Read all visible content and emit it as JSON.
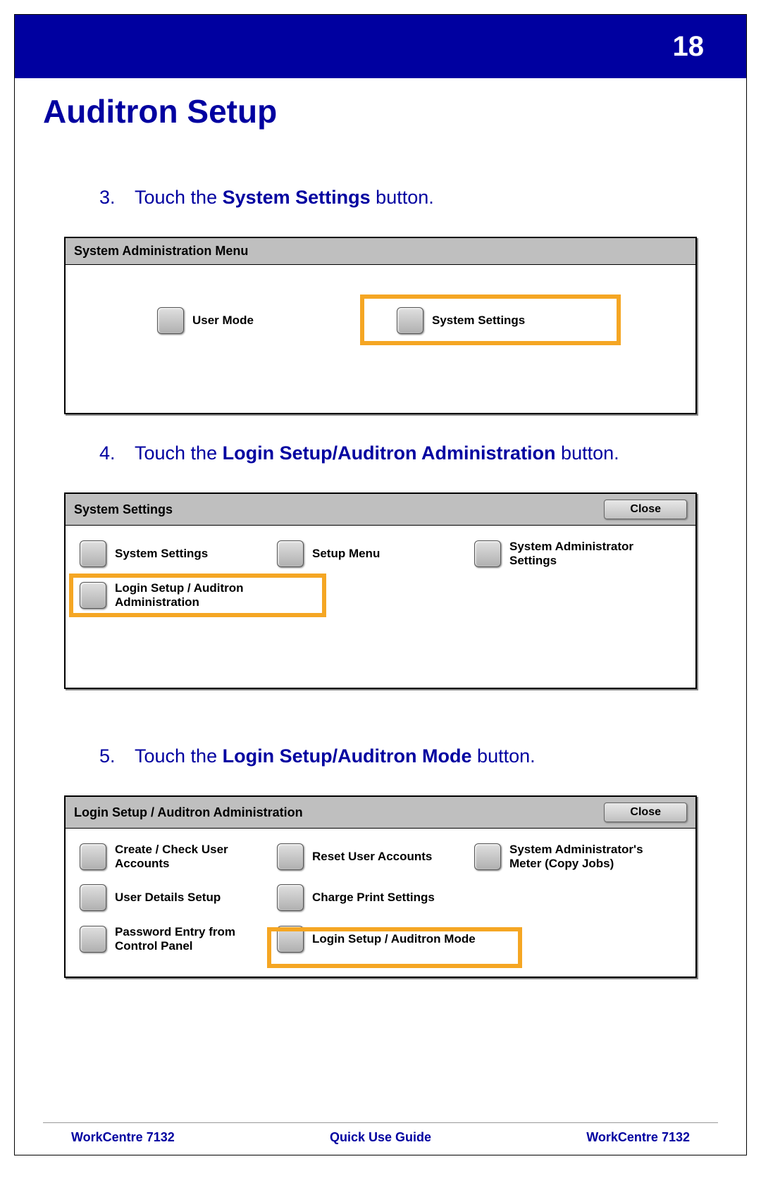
{
  "header": {
    "page_number": "18"
  },
  "title": "Auditron Setup",
  "steps": [
    {
      "num": "3.",
      "prefix": "Touch the ",
      "bold": "System Settings",
      "suffix": " button."
    },
    {
      "num": "4.",
      "prefix": "Touch the ",
      "bold": "Login Setup/Auditron Administration",
      "suffix": " button."
    },
    {
      "num": "5.",
      "prefix": "Touch the ",
      "bold": "Login Setup/Auditron Mode",
      "suffix": " button."
    }
  ],
  "panel1": {
    "title": "System Administration Menu",
    "buttons": {
      "user_mode": "User Mode",
      "system_settings": "System Settings"
    }
  },
  "panel2": {
    "title": "System Settings",
    "close": "Close",
    "buttons": {
      "system_settings": "System Settings",
      "setup_menu": "Setup Menu",
      "sys_admin_settings": "System Administrator Settings",
      "login_setup": "Login Setup / Auditron Administration"
    }
  },
  "panel3": {
    "title": "Login Setup / Auditron Administration",
    "close": "Close",
    "buttons": {
      "create_check": "Create / Check User Accounts",
      "reset_user": "Reset User Accounts",
      "sys_admin_meter": "System Administrator's Meter (Copy Jobs)",
      "user_details": "User Details Setup",
      "charge_print": "Charge Print Settings",
      "password_entry": "Password Entry from Control Panel",
      "login_mode": "Login Setup / Auditron Mode"
    }
  },
  "footer": {
    "left": "WorkCentre 7132",
    "center": "Quick Use Guide",
    "right": "WorkCentre 7132"
  }
}
